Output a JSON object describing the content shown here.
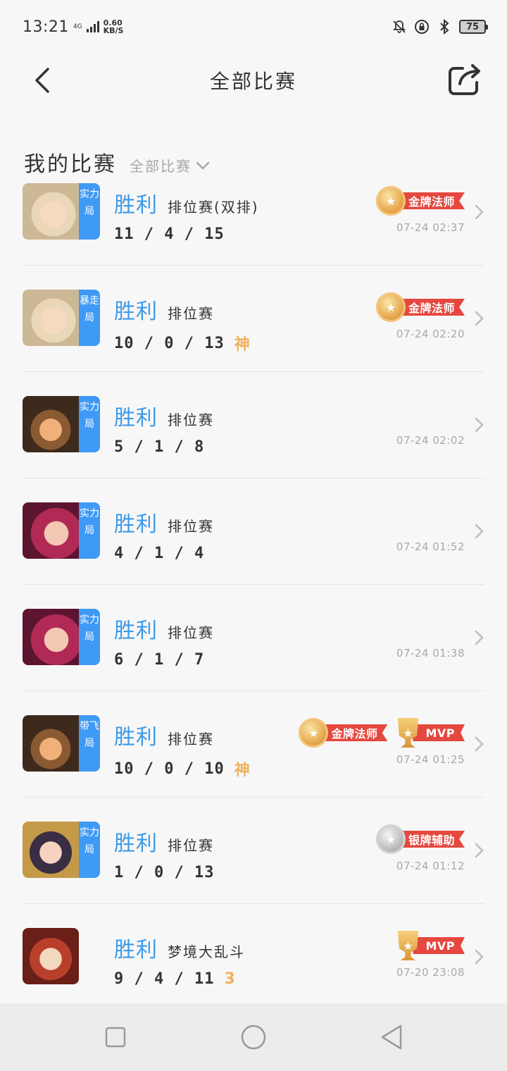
{
  "status_bar": {
    "time": "13:21",
    "network": "4G",
    "speed_value": "0.60",
    "speed_unit": "KB/S",
    "battery": "75"
  },
  "header": {
    "title": "全部比赛",
    "back_icon": "chevron-left-icon",
    "share_icon": "share-icon"
  },
  "section": {
    "title": "我的比赛",
    "filter_label": "全部比赛"
  },
  "colors": {
    "accent_blue": "#3b9ae8",
    "tag_blue": "#3f9af5",
    "badge_red": "#e5483f",
    "gold": "#f0b25c"
  },
  "matches": [
    {
      "mode_tag": "实力局",
      "result": "胜利",
      "type": "排位赛(双排)",
      "kda": "11 / 4 / 15",
      "extra": "",
      "badges": [
        {
          "kind": "gold",
          "label": "金牌法师"
        }
      ],
      "time": "07-24 02:37"
    },
    {
      "mode_tag": "暴走局",
      "result": "胜利",
      "type": "排位赛",
      "kda": "10 / 0 / 13",
      "extra": "神",
      "badges": [
        {
          "kind": "gold",
          "label": "金牌法师"
        }
      ],
      "time": "07-24 02:20"
    },
    {
      "mode_tag": "实力局",
      "result": "胜利",
      "type": "排位赛",
      "kda": "5 / 1 / 8",
      "extra": "",
      "badges": [],
      "time": "07-24 02:02"
    },
    {
      "mode_tag": "实力局",
      "result": "胜利",
      "type": "排位赛",
      "kda": "4 / 1 / 4",
      "extra": "",
      "badges": [],
      "time": "07-24 01:52"
    },
    {
      "mode_tag": "实力局",
      "result": "胜利",
      "type": "排位赛",
      "kda": "6 / 1 / 7",
      "extra": "",
      "badges": [],
      "time": "07-24 01:38"
    },
    {
      "mode_tag": "带飞局",
      "result": "胜利",
      "type": "排位赛",
      "kda": "10 / 0 / 10",
      "extra": "神",
      "badges": [
        {
          "kind": "gold",
          "label": "金牌法师"
        },
        {
          "kind": "mvp",
          "label": "MVP"
        }
      ],
      "time": "07-24 01:25"
    },
    {
      "mode_tag": "实力局",
      "result": "胜利",
      "type": "排位赛",
      "kda": "1 / 0 / 13",
      "extra": "",
      "badges": [
        {
          "kind": "silver",
          "label": "银牌辅助"
        }
      ],
      "time": "07-24 01:12"
    },
    {
      "mode_tag": "",
      "result": "胜利",
      "type": "梦境大乱斗",
      "kda": "9 / 4 / 11",
      "extra": "3",
      "badges": [
        {
          "kind": "mvp",
          "label": "MVP"
        }
      ],
      "time": "07-20 23:08"
    }
  ],
  "navbar": {
    "recent_icon": "square-icon",
    "home_icon": "circle-icon",
    "back_icon": "triangle-back-icon"
  }
}
